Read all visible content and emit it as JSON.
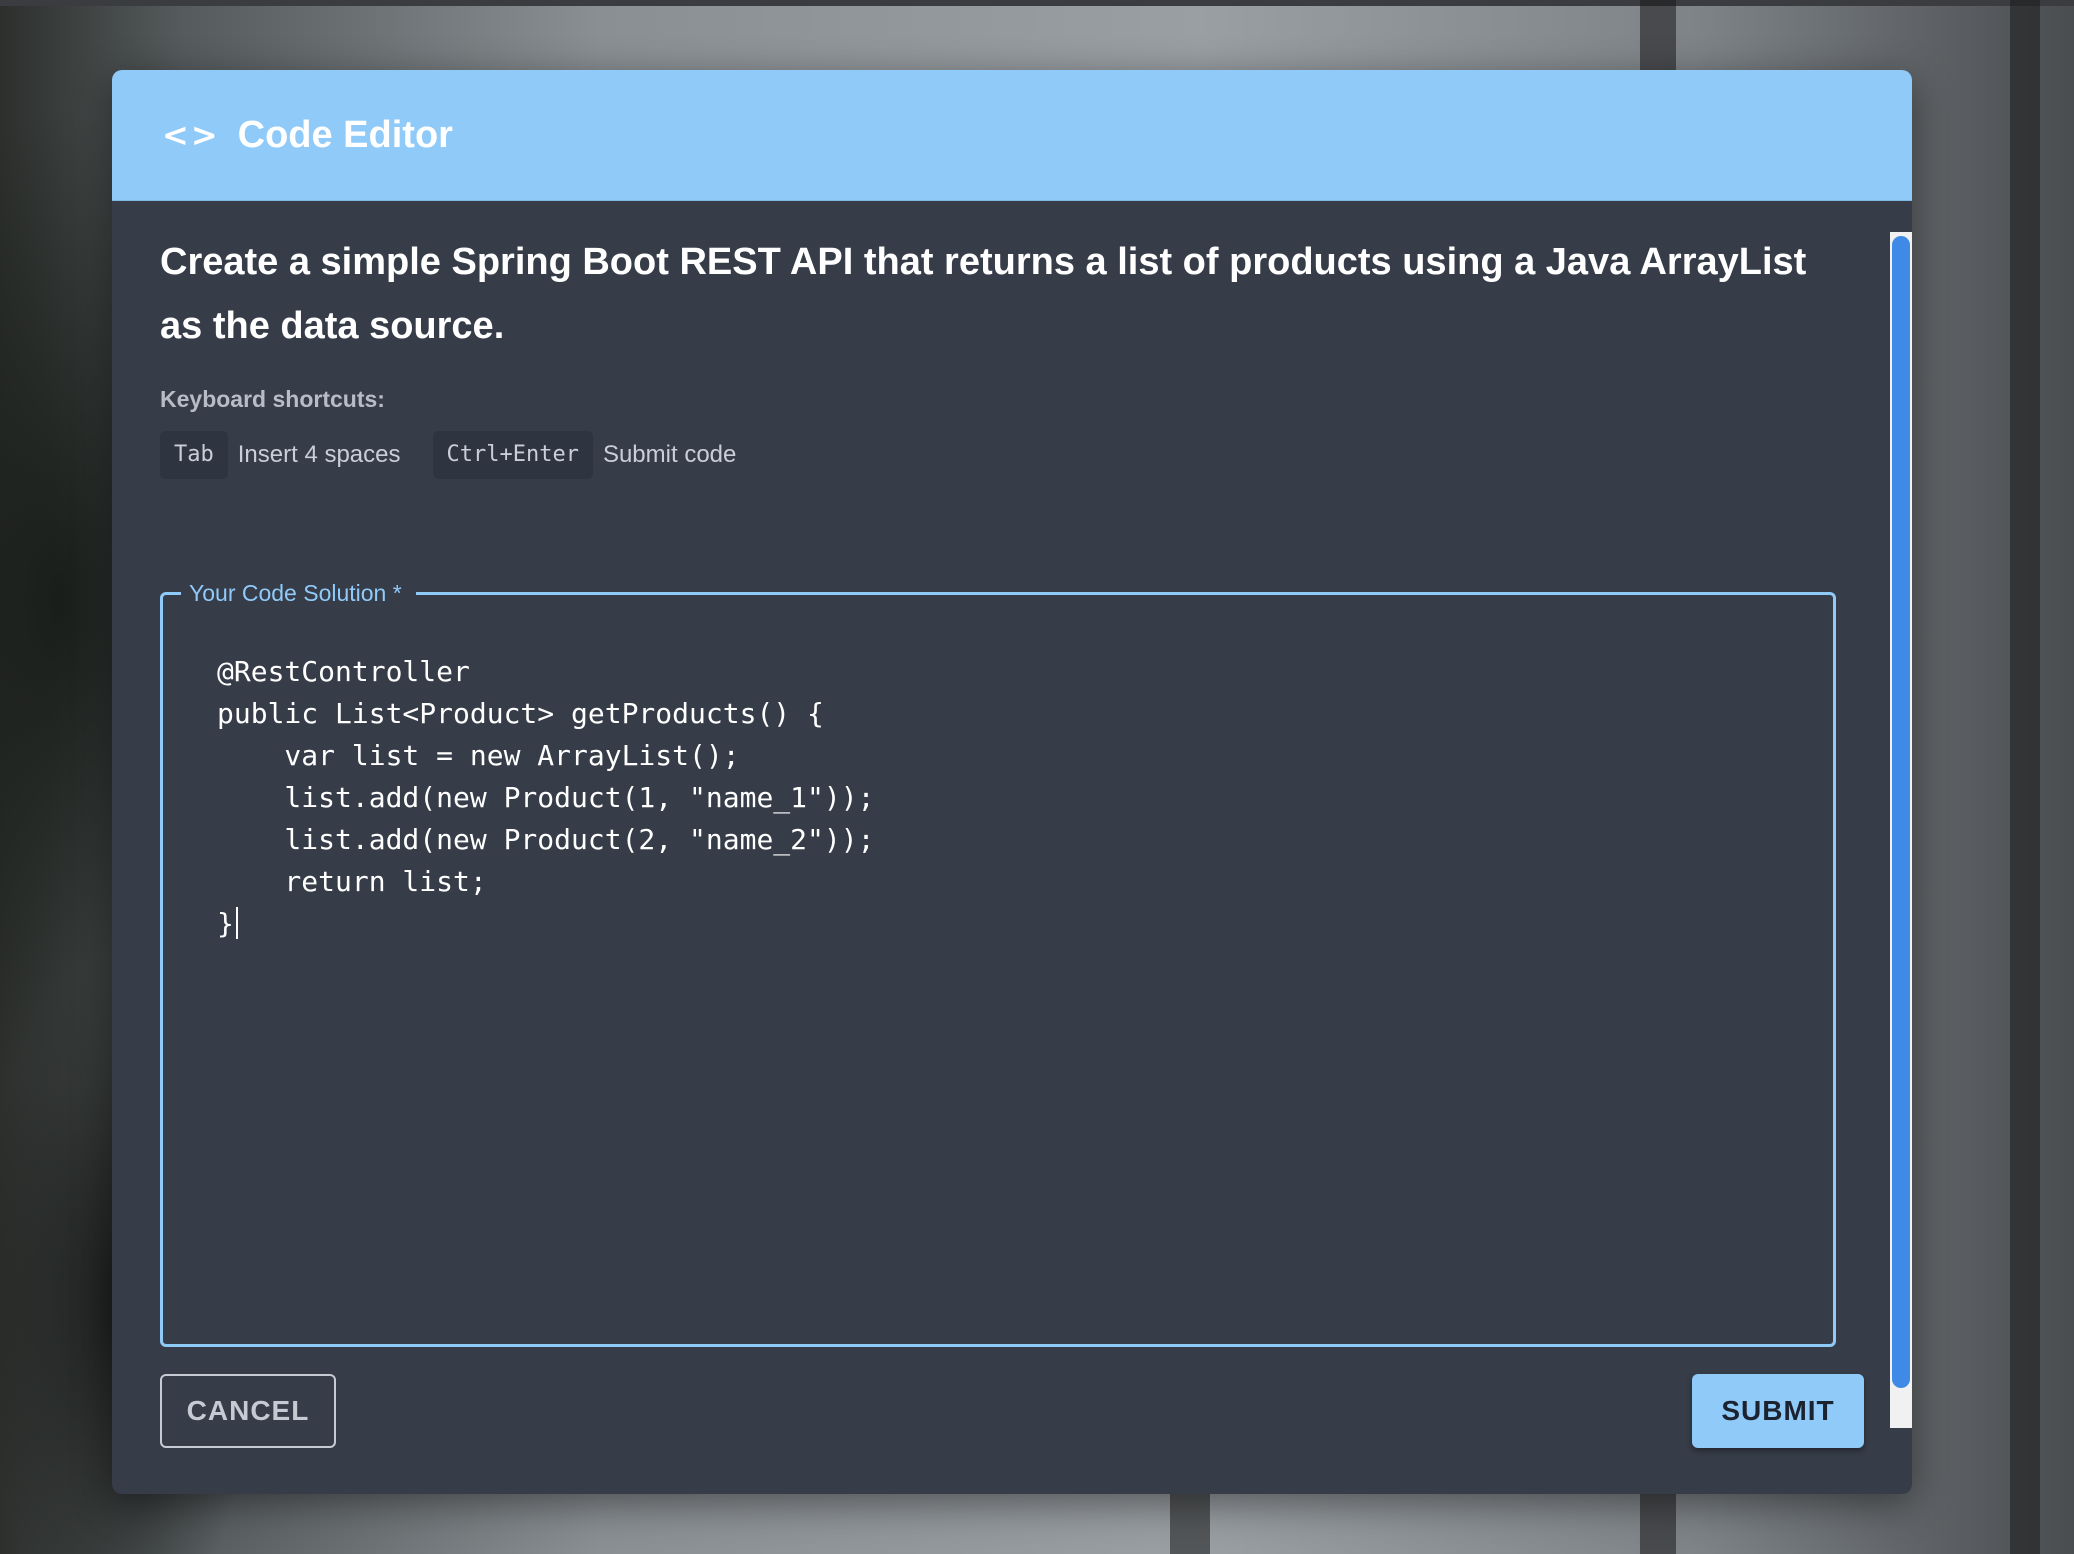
{
  "dialog": {
    "title": "Code Editor",
    "title_icon": "code-icon",
    "prompt": "Create a simple Spring Boot REST API that returns a list of products using a Java ArrayList as the data source.",
    "shortcuts_label": "Keyboard shortcuts:",
    "shortcuts": [
      {
        "key": "Tab",
        "description": "Insert 4 spaces"
      },
      {
        "key": "Ctrl+Enter",
        "description": "Submit code"
      }
    ],
    "code_field": {
      "label": "Your Code Solution *",
      "value": "@RestController\npublic List<Product> getProducts() {\n    var list = new ArrayList();\n    list.add(new Product(1, \"name_1\"));\n    list.add(new Product(2, \"name_2\"));\n    return list;\n}"
    },
    "cancel_label": "CANCEL",
    "submit_label": "SUBMIT"
  },
  "colors": {
    "header_bg": "#90caf9",
    "dialog_bg": "#363c48",
    "accent": "#90caf9",
    "scrollbar_thumb": "#3f8ae6"
  }
}
